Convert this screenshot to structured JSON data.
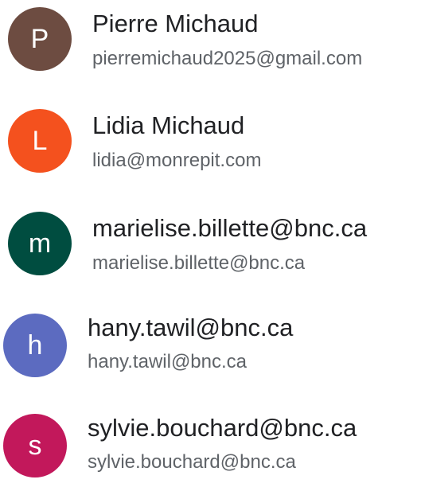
{
  "contacts": [
    {
      "initial": "P",
      "name": "Pierre Michaud",
      "email": "pierremichaud2025@gmail.com",
      "avatar_color": "#6D4C41"
    },
    {
      "initial": "L",
      "name": "Lidia Michaud",
      "email": "lidia@monrepit.com",
      "avatar_color": "#F4511E"
    },
    {
      "initial": "m",
      "name": "marielise.billette@bnc.ca",
      "email": "marielise.billette@bnc.ca",
      "avatar_color": "#004D40"
    },
    {
      "initial": "h",
      "name": "hany.tawil@bnc.ca",
      "email": "hany.tawil@bnc.ca",
      "avatar_color": "#5C6BC0"
    },
    {
      "initial": "s",
      "name": "sylvie.bouchard@bnc.ca",
      "email": "sylvie.bouchard@bnc.ca",
      "avatar_color": "#C2185B"
    }
  ]
}
